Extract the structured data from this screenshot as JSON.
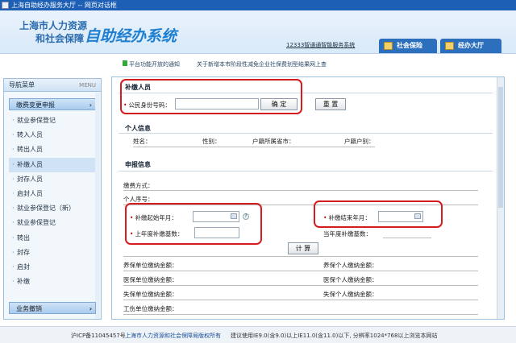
{
  "window": {
    "title": "上海自助经办服务大厅 -- 网页对话框"
  },
  "header": {
    "logo_line1": "上海市人力资源",
    "logo_line2": "和社会保障",
    "logo_big": "自助经办系统",
    "service_line": "12333智通通智能服务系统",
    "tabs": [
      {
        "label": "社会保险"
      },
      {
        "label": "经办大厅"
      }
    ]
  },
  "notices": [
    "平台功能开放的通知",
    "关于新增本市阶段性减免企业社保费划型结果网上查"
  ],
  "sidebar": {
    "title": "导航菜单",
    "menu_label": "MENU",
    "group": "缴费变更申报",
    "items": [
      {
        "label": "就业参保登记"
      },
      {
        "label": "转入人员"
      },
      {
        "label": "转出人员"
      },
      {
        "label": "补缴人员"
      },
      {
        "label": "封存人员"
      },
      {
        "label": "启封人员"
      },
      {
        "label": "就业参保登记（新）"
      },
      {
        "label": "就业参保登记"
      },
      {
        "label": "转出"
      },
      {
        "label": "封存"
      },
      {
        "label": "启封"
      },
      {
        "label": "补缴"
      }
    ],
    "bottom_group": "业务撤销"
  },
  "form": {
    "section_supplement": "补缴人员",
    "id_label": "公民身份号码：",
    "id_value": "",
    "confirm_button": "确 定",
    "reset_button": "重 置",
    "section_personal": "个人信息",
    "personal_fields": [
      "姓名：",
      "性别：",
      "户籍所属省市：",
      "户籍户别："
    ],
    "section_apply": "申报信息",
    "pay_method_label": "缴费方式：",
    "personal_seq_label": "个人序号：",
    "start_ym_label": "补缴起始年月：",
    "end_ym_label": "补缴结束年月：",
    "prev_base_label": "上年度补缴基数：",
    "curr_base_label": "当年度补缴基数：",
    "calc_button": "计 算",
    "pension_unit": "养保单位缴纳金额：",
    "pension_person": "养保个人缴纳金额：",
    "medical_unit": "医保单位缴纳金额：",
    "medical_person": "医保个人缴纳金额：",
    "unemp_unit": "失保单位缴纳金额：",
    "unemp_person": "失保个人缴纳金额：",
    "injury_unit": "工伤单位缴纳金额："
  },
  "footer": {
    "icp": "沪ICP备11045457号",
    "owner": "上海市人力资源和社会保障局版权所有",
    "browser_note": "建议使用IE9.0(含9.0)以上IE11.0(含11.0)以下, 分辨率1024*768以上浏览本网站"
  },
  "colors": {
    "header_blue": "#1d5fb4",
    "highlight_red": "#d41c1c",
    "accent": "#1e7fd1"
  }
}
